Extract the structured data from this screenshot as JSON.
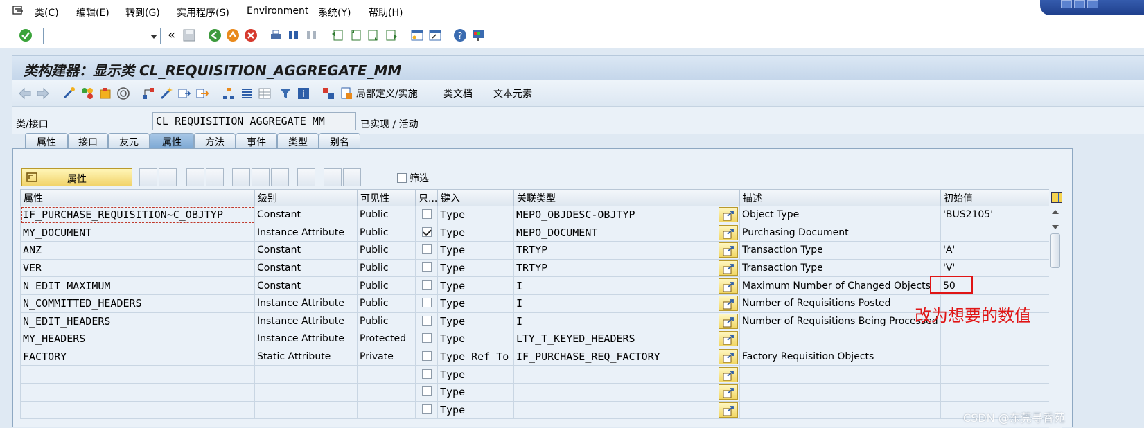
{
  "menubar": {
    "items": [
      "类(C)",
      "编辑(E)",
      "转到(G)",
      "实用程序(S)",
      "Environment",
      "系统(Y)",
      "帮助(H)"
    ]
  },
  "toolbar": {
    "command_field": ""
  },
  "title": "类构建器：显示类 CL_REQUISITION_AGGREGATE_MM",
  "app_toolbar": {
    "local_def": "局部定义/实施",
    "class_doc": "类文档",
    "text_elements": "文本元素"
  },
  "class_row": {
    "label": "类/接口",
    "value": "CL_REQUISITION_AGGREGATE_MM",
    "status": "已实现 / 活动"
  },
  "tabs": [
    "属性",
    "接口",
    "友元",
    "属性",
    "方法",
    "事件",
    "类型",
    "别名"
  ],
  "active_tab": 3,
  "panel": {
    "attr_button": "属性",
    "filter_label": "筛选"
  },
  "table": {
    "headers": [
      "属性",
      "级别",
      "可见性",
      "只...",
      "键入",
      "关联类型",
      "",
      "描述",
      "初始值"
    ],
    "rows": [
      {
        "attr": "IF_PURCHASE_REQUISITION~C_OBJTYP",
        "level": "Constant",
        "vis": "Public",
        "ro": false,
        "typing": "Type",
        "ref": "MEPO_OBJDESC-OBJTYP",
        "desc": "Object Type",
        "init": "'BUS2105'"
      },
      {
        "attr": "MY_DOCUMENT",
        "level": "Instance Attribute",
        "vis": "Public",
        "ro": true,
        "typing": "Type",
        "ref": "MEPO_DOCUMENT",
        "desc": "Purchasing Document",
        "init": ""
      },
      {
        "attr": "ANZ",
        "level": "Constant",
        "vis": "Public",
        "ro": false,
        "typing": "Type",
        "ref": "TRTYP",
        "desc": "Transaction Type",
        "init": "'A'"
      },
      {
        "attr": "VER",
        "level": "Constant",
        "vis": "Public",
        "ro": false,
        "typing": "Type",
        "ref": "TRTYP",
        "desc": "Transaction Type",
        "init": "'V'"
      },
      {
        "attr": "N_EDIT_MAXIMUM",
        "level": "Constant",
        "vis": "Public",
        "ro": false,
        "typing": "Type",
        "ref": "I",
        "desc": "Maximum Number of Changed Objects",
        "init": "50"
      },
      {
        "attr": "N_COMMITTED_HEADERS",
        "level": "Instance Attribute",
        "vis": "Public",
        "ro": false,
        "typing": "Type",
        "ref": "I",
        "desc": "Number of Requisitions Posted",
        "init": ""
      },
      {
        "attr": "N_EDIT_HEADERS",
        "level": "Instance Attribute",
        "vis": "Public",
        "ro": false,
        "typing": "Type",
        "ref": "I",
        "desc": "Number of Requisitions Being Processed",
        "init": ""
      },
      {
        "attr": "MY_HEADERS",
        "level": "Instance Attribute",
        "vis": "Protected",
        "ro": false,
        "typing": "Type",
        "ref": "LTY_T_KEYED_HEADERS",
        "desc": "",
        "init": ""
      },
      {
        "attr": "FACTORY",
        "level": "Static Attribute",
        "vis": "Private",
        "ro": false,
        "typing": "Type Ref To",
        "ref": "IF_PURCHASE_REQ_FACTORY",
        "desc": "Factory Requisition Objects",
        "init": ""
      },
      {
        "attr": "",
        "level": "",
        "vis": "",
        "ro": false,
        "typing": "Type",
        "ref": "",
        "desc": "",
        "init": ""
      },
      {
        "attr": "",
        "level": "",
        "vis": "",
        "ro": false,
        "typing": "Type",
        "ref": "",
        "desc": "",
        "init": ""
      },
      {
        "attr": "",
        "level": "",
        "vis": "",
        "ro": false,
        "typing": "Type",
        "ref": "",
        "desc": "",
        "init": ""
      }
    ]
  },
  "annotation": {
    "note": "改为想要的数值",
    "color": "#e01515"
  },
  "watermark": "CSDN @东莞寻香苑",
  "colors": {
    "background": "#dfe9f3",
    "active_tab": "#7ea9d4",
    "nav_button": "#f1d664"
  }
}
